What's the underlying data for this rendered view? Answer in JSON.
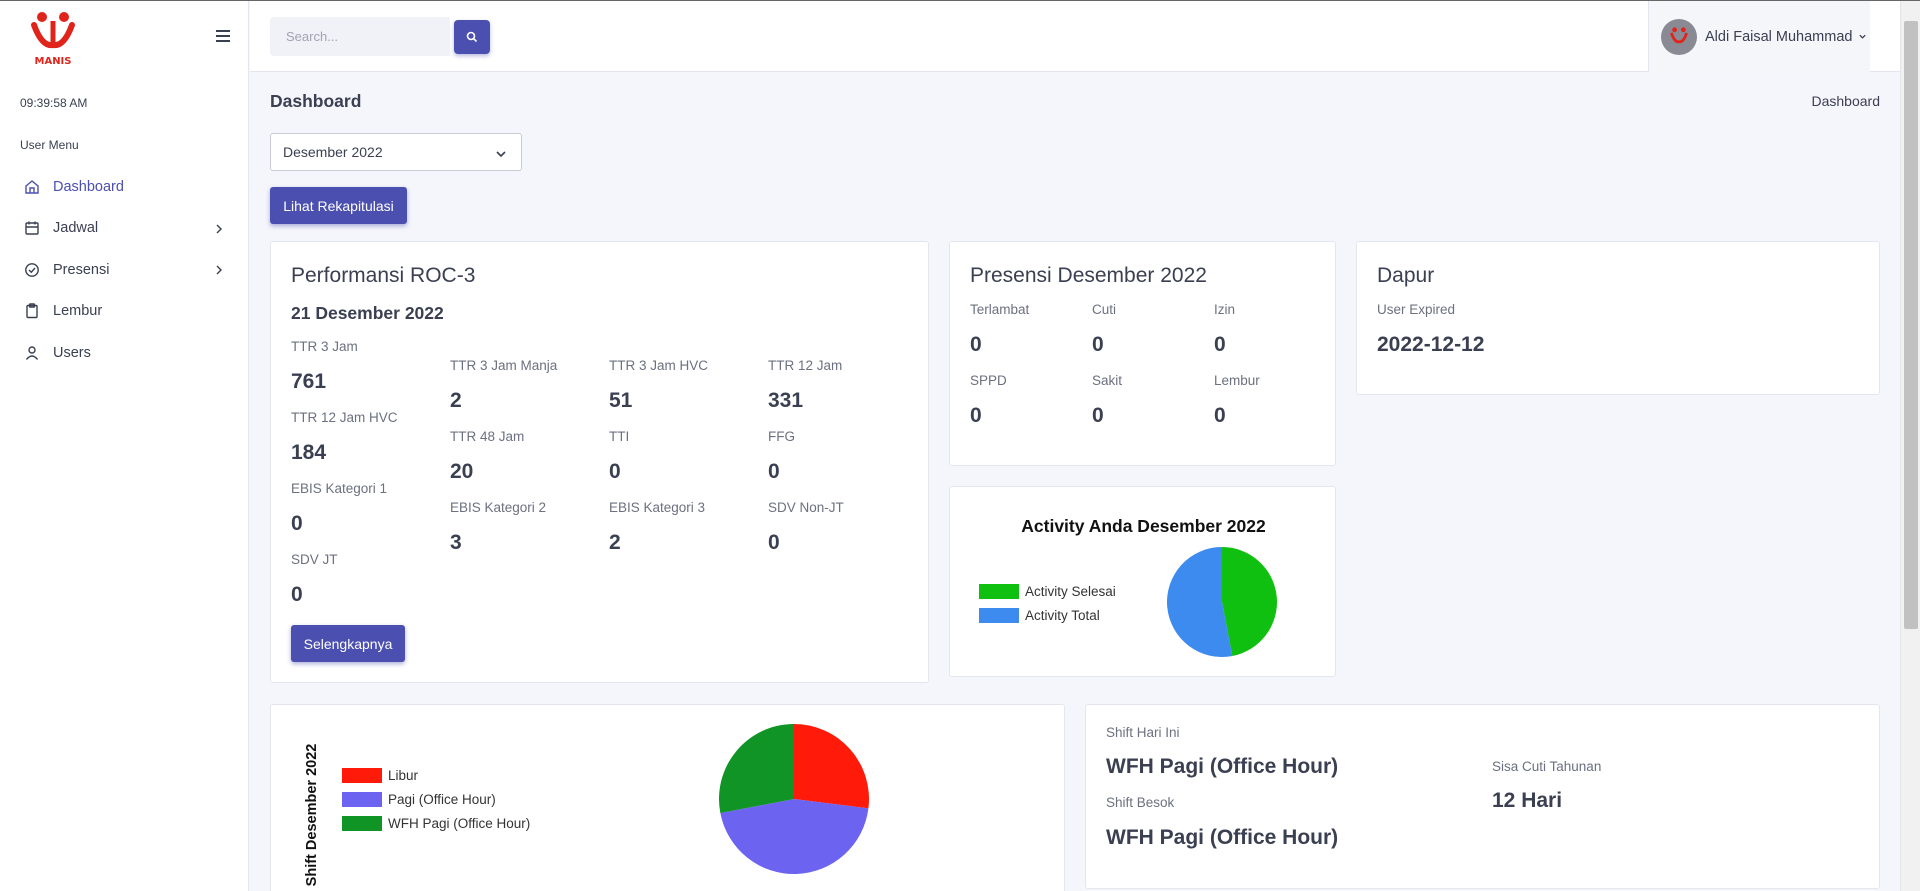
{
  "app": {
    "logo_text": "MANIS"
  },
  "sidebar": {
    "clock": "09:39:58 AM",
    "menu_title": "User Menu",
    "items": [
      {
        "label": "Dashboard",
        "icon": "home-icon",
        "active": true
      },
      {
        "label": "Jadwal",
        "icon": "calendar-icon",
        "has_submenu": true
      },
      {
        "label": "Presensi",
        "icon": "check-circle-icon",
        "has_submenu": true
      },
      {
        "label": "Lembur",
        "icon": "clipboard-icon"
      },
      {
        "label": "Users",
        "icon": "user-icon"
      }
    ]
  },
  "header": {
    "search_placeholder": "Search...",
    "user_name": "Aldi Faisal Muhammad"
  },
  "page": {
    "title": "Dashboard",
    "breadcrumb": "Dashboard",
    "month_select": "Desember 2022",
    "recap_button": "Lihat Rekapitulasi"
  },
  "performansi": {
    "title": "Performansi ROC-3",
    "date": "21 Desember 2022",
    "metrics": [
      {
        "label": "TTR 3 Jam",
        "value": "761"
      },
      {
        "label": "TTR 12 Jam HVC",
        "value": "184"
      },
      {
        "label": "EBIS Kategori 1",
        "value": "0"
      },
      {
        "label": "SDV JT",
        "value": "0"
      },
      {
        "label": "TTR 3 Jam Manja",
        "value": "2"
      },
      {
        "label": "TTR 48 Jam",
        "value": "20"
      },
      {
        "label": "EBIS Kategori 2",
        "value": "3"
      },
      {
        "label": "TTR 3 Jam HVC",
        "value": "51"
      },
      {
        "label": "TTI",
        "value": "0"
      },
      {
        "label": "EBIS Kategori 3",
        "value": "2"
      },
      {
        "label": "TTR 12 Jam",
        "value": "331"
      },
      {
        "label": "FFG",
        "value": "0"
      },
      {
        "label": "SDV Non-JT",
        "value": "0"
      }
    ],
    "more_button": "Selengkapnya"
  },
  "presensi": {
    "title": "Presensi Desember 2022",
    "items": [
      {
        "label": "Terlambat",
        "value": "0"
      },
      {
        "label": "Cuti",
        "value": "0"
      },
      {
        "label": "Izin",
        "value": "0"
      },
      {
        "label": "SPPD",
        "value": "0"
      },
      {
        "label": "Sakit",
        "value": "0"
      },
      {
        "label": "Lembur",
        "value": "0"
      }
    ]
  },
  "dapur": {
    "title": "Dapur",
    "label": "User Expired",
    "value": "2022-12-12"
  },
  "activity": {
    "chart_data": {
      "type": "pie",
      "title": "Activity Anda Desember 2022",
      "series": [
        {
          "name": "Activity Selesai",
          "value": 47,
          "color": "#10c010"
        },
        {
          "name": "Activity Total",
          "value": 53,
          "color": "#3d8bef"
        }
      ],
      "legend": "left"
    }
  },
  "shift_chart": {
    "chart_data": {
      "type": "pie",
      "title": "Shift Desember 2022",
      "series": [
        {
          "name": "Libur",
          "value": 27,
          "color": "#ff1a0a"
        },
        {
          "name": "Pagi (Office Hour)",
          "value": 45,
          "color": "#6c63f0"
        },
        {
          "name": "WFH Pagi (Office Hour)",
          "value": 28,
          "color": "#109426"
        }
      ],
      "legend": "left"
    }
  },
  "shift_info": {
    "today_label": "Shift Hari Ini",
    "today_value": "WFH Pagi (Office Hour)",
    "tomorrow_label": "Shift Besok",
    "tomorrow_value": "WFH Pagi (Office Hour)",
    "leave_label": "Sisa Cuti Tahunan",
    "leave_value": "12 Hari"
  }
}
